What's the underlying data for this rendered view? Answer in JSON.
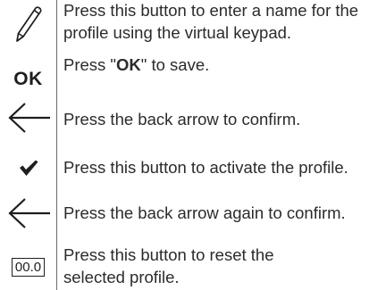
{
  "rows": [
    {
      "icon": "pencil-icon",
      "text": "Press this button to enter a name for the profile using the virtual keypad."
    },
    {
      "icon": "ok-button",
      "icon_label": "OK",
      "text_before": "Press \"",
      "text_bold": "OK",
      "text_after": "\" to save."
    },
    {
      "icon": "back-arrow-icon",
      "text": "Press the back arrow to confirm."
    },
    {
      "icon": "checkmark-icon",
      "text": "Press this button to activate the profile."
    },
    {
      "icon": "back-arrow-icon",
      "text": "Press the back arrow again to confirm."
    },
    {
      "icon": "reset-value-button",
      "icon_label": "00.0",
      "text": "Press this button to reset the selected profile."
    }
  ]
}
